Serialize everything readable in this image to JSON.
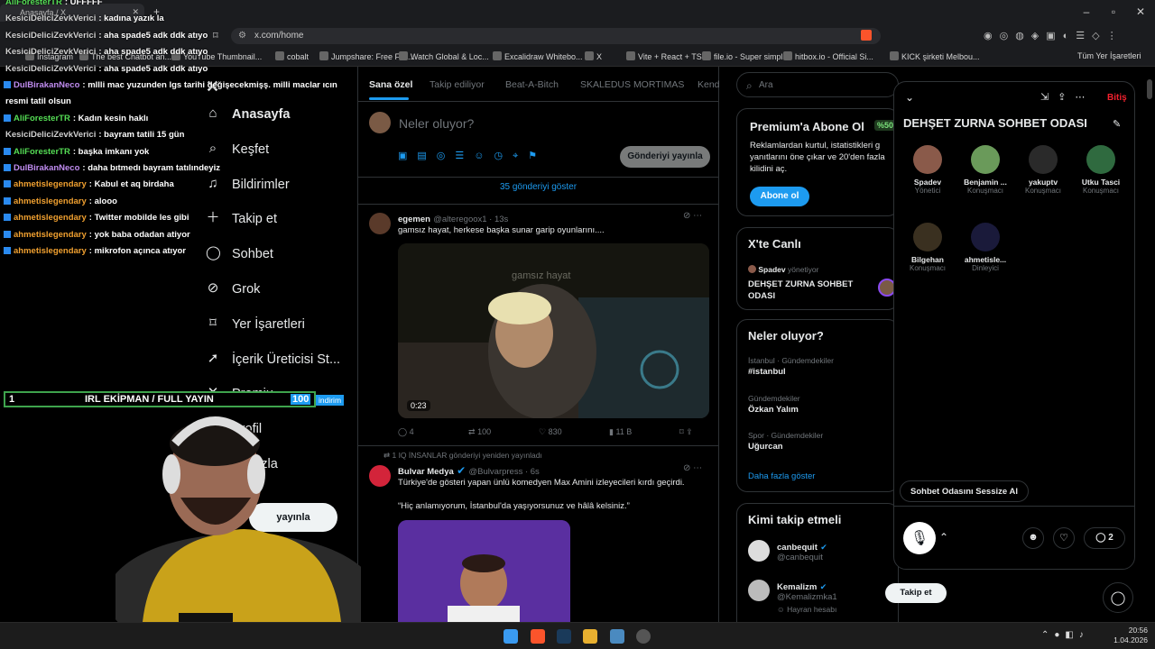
{
  "browser": {
    "tab_title": "Anasayfa / X",
    "url": "x.com/home",
    "bookmarks": [
      "Instagram",
      "The best Chatbot an...",
      "YouTube Thumbnail...",
      "cobalt",
      "Jumpshare: Free File...",
      "Watch Global & Loc...",
      "Excalidraw Whitebo...",
      "X",
      "Vite + React + TS",
      "file.io - Super simpl...",
      "hitbox.io - Official Si...",
      "KICK şirketi Melbou..."
    ],
    "all_bookmarks": "Tüm Yer İşaretleri"
  },
  "chat": [
    {
      "user": "AliForesterTR",
      "msg": "UFFFFF",
      "color": "#55dd55",
      "badge": false
    },
    {
      "user": "KesiciDeliciZevkVerici",
      "msg": "kadına yazık la",
      "color": "#d0d0d0",
      "badge": false
    },
    {
      "user": "KesiciDeliciZevkVerici",
      "msg": "aha spade5 adk ddk atıyo",
      "color": "#d0d0d0",
      "badge": false
    },
    {
      "user": "KesiciDeliciZevkVerici",
      "msg": "aha spade5 adk ddk atıyo",
      "color": "#d0d0d0",
      "badge": false
    },
    {
      "user": "KesiciDeliciZevkVerici",
      "msg": "aha spade5 adk ddk atıyo",
      "color": "#d0d0d0",
      "badge": false
    },
    {
      "user": "DulBirakanNeco",
      "msg": "mllli mac yuzunden lgs tarihi değişecekmişş. milli maclar ıcın",
      "color": "#c08cf0",
      "badge": true
    },
    {
      "user": "",
      "msg": "resmi tatil olsun",
      "color": "#fff",
      "badge": false
    },
    {
      "user": "AliForesterTR",
      "msg": "Kadın kesin haklı",
      "color": "#55dd55",
      "badge": true
    },
    {
      "user": "KesiciDeliciZevkVerici",
      "msg": "bayram tatili 15 gün",
      "color": "#d0d0d0",
      "badge": false
    },
    {
      "user": "AliForesterTR",
      "msg": "başka imkanı yok",
      "color": "#55dd55",
      "badge": true
    },
    {
      "user": "DulBirakanNeco",
      "msg": "daha bıtmedı bayram tatılındeyiz",
      "color": "#c08cf0",
      "badge": true
    },
    {
      "user": "ahmetislegendary",
      "msg": "Kabul et aq birdaha",
      "color": "#f0a030",
      "badge": true
    },
    {
      "user": "ahmetislegendary",
      "msg": "alooo",
      "color": "#f0a030",
      "badge": true
    },
    {
      "user": "ahmetislegendary",
      "msg": "Twitter mobilde les gibi",
      "color": "#f0a030",
      "badge": true
    },
    {
      "user": "ahmetislegendary",
      "msg": "yok baba odadan atiyor",
      "color": "#f0a030",
      "badge": true
    },
    {
      "user": "ahmetislegendary",
      "msg": "mikrofon açınca atıyor",
      "color": "#f0a030",
      "badge": true
    }
  ],
  "overlay": {
    "left": "1",
    "text": "IRL EKİPMAN / FULL YAYIN",
    "count": "100",
    "badge": "indirim"
  },
  "nav": [
    {
      "icon": "home-icon",
      "glyph": "⌂",
      "label": "Anasayfa"
    },
    {
      "icon": "search-icon",
      "glyph": "⌕",
      "label": "Keşfet"
    },
    {
      "icon": "bell-icon",
      "glyph": "♫",
      "label": "Bildirimler"
    },
    {
      "icon": "follow-icon",
      "glyph": "＋",
      "label": "Takip et"
    },
    {
      "icon": "chat-icon",
      "glyph": "◯",
      "label": "Sohbet"
    },
    {
      "icon": "grok-icon",
      "glyph": "⊘",
      "label": "Grok"
    },
    {
      "icon": "bookmark-icon",
      "glyph": "⌑",
      "label": "Yer İşaretleri"
    },
    {
      "icon": "rocket-icon",
      "glyph": "➚",
      "label": "İçerik Üreticisi St..."
    },
    {
      "icon": "premium-icon",
      "glyph": "✕",
      "label": "Premiu..."
    },
    {
      "icon": "profile-icon",
      "glyph": "☺",
      "label": "Profil"
    },
    {
      "icon": "more-icon",
      "glyph": "⋯",
      "label": "ha fazla"
    }
  ],
  "post_button": "yayınla",
  "feed": {
    "tabs": [
      "Sana özel",
      "Takip ediliyor",
      "Beat-A-Bitch",
      "SKALEDUS MORTIMAS",
      "Kend"
    ],
    "compose_placeholder": "Neler oluyor?",
    "compose_button": "Gönderiyi yayınla",
    "show_posts": "35 gönderiyi göster",
    "post1": {
      "name": "egemen",
      "handle": "@alteregoox1 · 13s",
      "text": "gamsız hayat, herkese başka sunar garip oyunlarını....",
      "video_time": "0:23",
      "video_watermark": "gamsız hayat",
      "replies": "4",
      "reposts": "100",
      "likes": "830",
      "views": "11 B"
    },
    "repost_note": "1 IQ İNSANLAR gönderiyi yeniden yayınladı",
    "post2": {
      "name": "Bulvar Medya",
      "handle": "@Bulvarpress · 6s",
      "text1": "Türkiye'de gösteri yapan ünlü komedyen Max Amini izleyecileri kırdı geçirdi.",
      "text2": "“Hiç anlamıyorum, İstanbul'da yaşıyorsunuz ve hâlâ kelsiniz.”"
    }
  },
  "right": {
    "search_placeholder": "Ara",
    "premium": {
      "title": "Premium'a Abone Ol",
      "badge": "%50",
      "text": "Reklamlardan kurtul, istatistikleri g yanıtlarını öne çıkar ve 20'den fazla kilidini aç.",
      "button": "Abone ol"
    },
    "live": {
      "title": "X'te Canlı",
      "host": "Spadev",
      "host_role": "yönetiyor",
      "space": "DEHŞET ZURNA SOHBET ODASI"
    },
    "trends": {
      "title": "Neler oluyor?",
      "items": [
        {
          "meta": "İstanbul · Gündemdekiler",
          "tag": "#istanbul"
        },
        {
          "meta": "Gündemdekiler",
          "tag": "Özkan Yalım"
        },
        {
          "meta": "Spor · Gündemdekiler",
          "tag": "Uğurcan"
        }
      ],
      "more": "Daha fazla göster"
    },
    "who": {
      "title": "Kimi takip etmeli",
      "users": [
        {
          "name": "canbequit",
          "handle": "@canbequit"
        },
        {
          "name": "Kemalizm",
          "handle": "@Kemalizmka1",
          "note": "Hayran hesabı",
          "button": "Takip et"
        }
      ]
    }
  },
  "space": {
    "title": "DEHŞET ZURNA SOHBET ODASI",
    "leave": "Bitiş",
    "participants": [
      {
        "name": "Spadev",
        "role": "Yönetici",
        "color": "#8a5a4a"
      },
      {
        "name": "Benjamin ...",
        "role": "Konuşmacı",
        "color": "#6a9a5a"
      },
      {
        "name": "yakuptv",
        "role": "Konuşmacı",
        "color": "#2a2a2a"
      },
      {
        "name": "Utku Tasci",
        "role": "Konuşmacı",
        "color": "#2f6a3f"
      },
      {
        "name": "Bilgehan",
        "role": "Konuşmacı",
        "color": "#3a3020"
      },
      {
        "name": "ahmetisle...",
        "role": "Dinleyici",
        "color": "#1a1a3a"
      }
    ],
    "mute_all": "Sohbet Odasını Sessize Al",
    "reply_count": "2"
  },
  "taskbar": {
    "time": "20:56",
    "date": "1.04.2026"
  },
  "colors": {
    "accent": "#1d9bf0",
    "bg": "#000000",
    "border": "#2f3336",
    "leave": "#f4212e"
  }
}
